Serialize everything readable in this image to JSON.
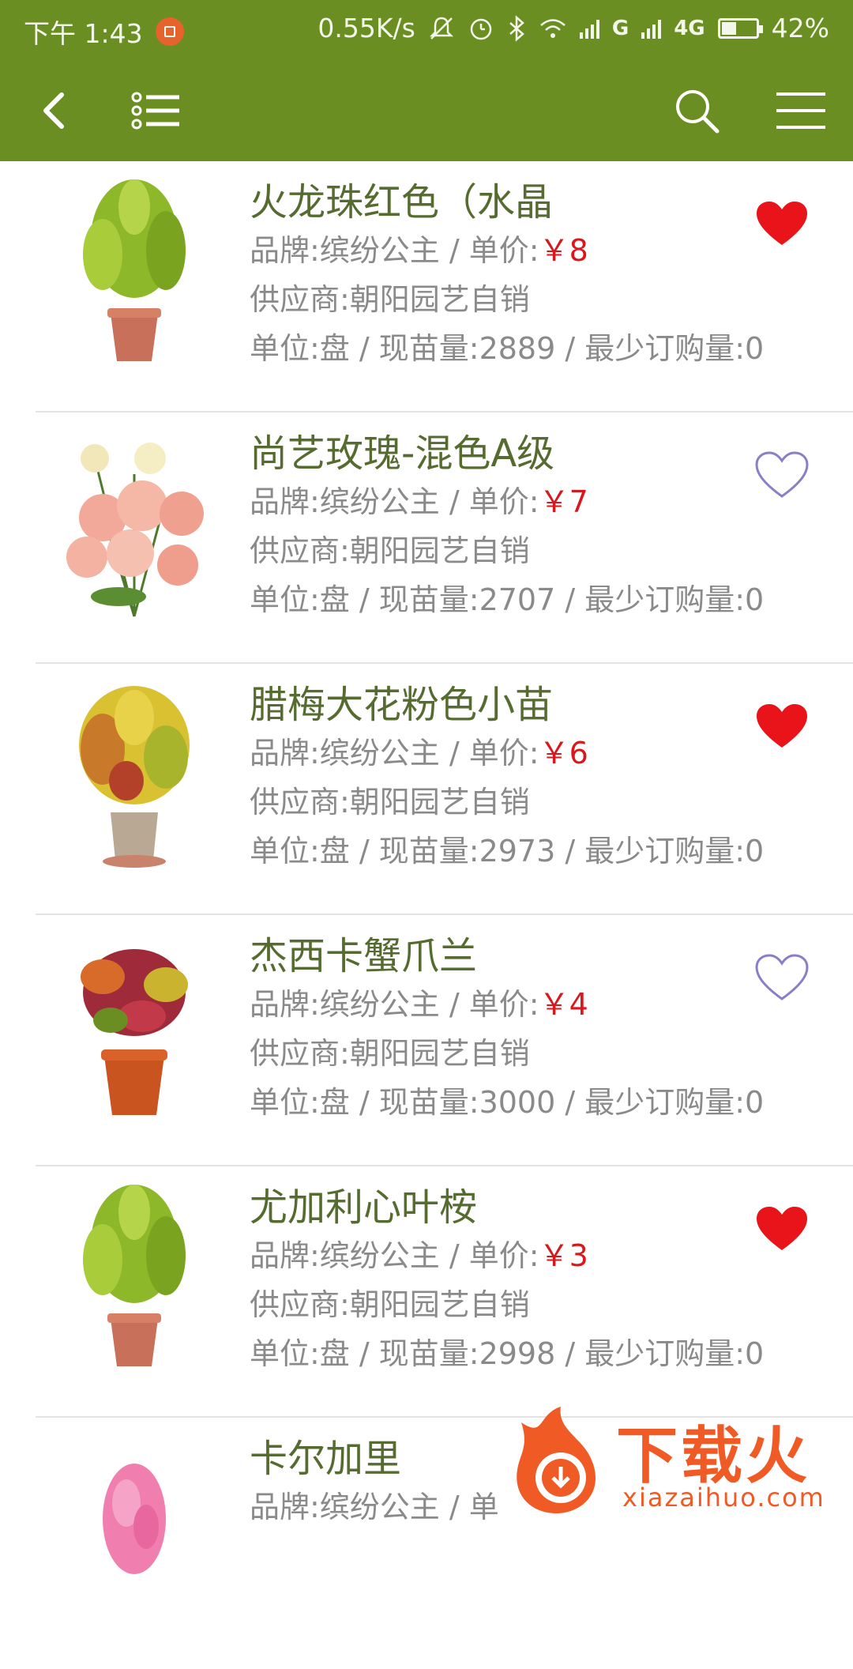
{
  "status_bar": {
    "time": "下午 1:43",
    "speed": "0.55K/s",
    "network_g": "G",
    "network_4g": "4G",
    "battery": "42%"
  },
  "toolbar": {
    "back_icon": "chevron-left-icon",
    "list_icon": "list-icon",
    "search_icon": "search-icon",
    "menu_icon": "hamburger-icon"
  },
  "products": [
    {
      "name": "火龙珠红色（水晶",
      "brand_label": "品牌:缤纷公主 / 单价:",
      "price": "￥8",
      "supplier": "供应商:朝阳园艺自销",
      "stock_line": "单位:盘 / 现苗量:2889 / 最少订购量:0",
      "favorited": true
    },
    {
      "name": "尚艺玫瑰-混色A级",
      "brand_label": "品牌:缤纷公主 / 单价:",
      "price": "￥7",
      "supplier": "供应商:朝阳园艺自销",
      "stock_line": "单位:盘 / 现苗量:2707 / 最少订购量:0",
      "favorited": false
    },
    {
      "name": "腊梅大花粉色小苗",
      "brand_label": "品牌:缤纷公主 / 单价:",
      "price": "￥6",
      "supplier": "供应商:朝阳园艺自销",
      "stock_line": "单位:盘 / 现苗量:2973 / 最少订购量:0",
      "favorited": true
    },
    {
      "name": "杰西卡蟹爪兰",
      "brand_label": "品牌:缤纷公主 / 单价:",
      "price": "￥4",
      "supplier": "供应商:朝阳园艺自销",
      "stock_line": "单位:盘 / 现苗量:3000 / 最少订购量:0",
      "favorited": false
    },
    {
      "name": "尤加利心叶桉",
      "brand_label": "品牌:缤纷公主 / 单价:",
      "price": "￥3",
      "supplier": "供应商:朝阳园艺自销",
      "stock_line": "单位:盘 / 现苗量:2998 / 最少订购量:0",
      "favorited": true
    },
    {
      "name": "卡尔加里",
      "brand_label": "品牌:缤纷公主 / 单",
      "price": "",
      "supplier": "",
      "stock_line": "",
      "favorited": false
    }
  ],
  "watermark": {
    "title": "下载火",
    "url": "xiazaihuo.com"
  },
  "colors": {
    "header": "#6b8e23",
    "name": "#556b2f",
    "price": "#d8181c",
    "heart_filled": "#e8141a",
    "heart_outline": "#8a7fc6"
  }
}
